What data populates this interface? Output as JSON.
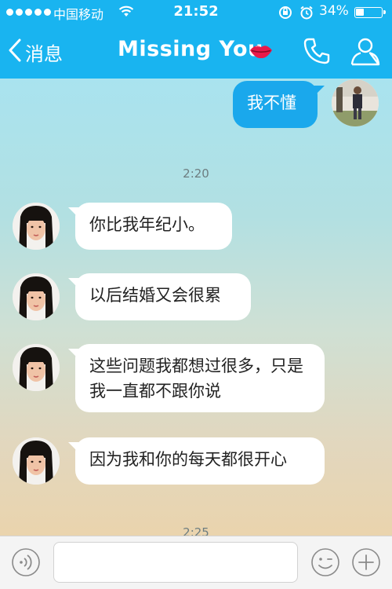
{
  "status_bar": {
    "carrier": "中国移动",
    "time": "21:52",
    "battery_percent": "34%",
    "battery_level": 0.34,
    "signal_dots": 5,
    "icons": [
      "wifi-icon",
      "rotation-lock-icon",
      "alarm-icon",
      "battery-icon"
    ]
  },
  "nav": {
    "back_label": "消息",
    "title": "Missing  You",
    "icons": [
      "back-chevron-icon",
      "lips-icon",
      "phone-icon",
      "profile-icon"
    ]
  },
  "messages": [
    {
      "side": "out",
      "text": "我不懂"
    },
    {
      "type": "timestamp",
      "text": "2:20"
    },
    {
      "side": "in",
      "text": "你比我年纪小。"
    },
    {
      "side": "in",
      "text": "以后结婚又会很累"
    },
    {
      "side": "in",
      "text": "这些问题我都想过很多，只是我一直都不跟你说"
    },
    {
      "side": "in",
      "text": "因为我和你的每天都很开心"
    },
    {
      "type": "timestamp",
      "text": "2:25"
    }
  ],
  "input_bar": {
    "placeholder": "",
    "icons": [
      "voice-icon",
      "emoji-icon",
      "plus-icon"
    ]
  },
  "colors": {
    "accent": "#19b4f0",
    "outgoing_bubble": "#1aa8ec",
    "incoming_bubble": "#ffffff"
  }
}
